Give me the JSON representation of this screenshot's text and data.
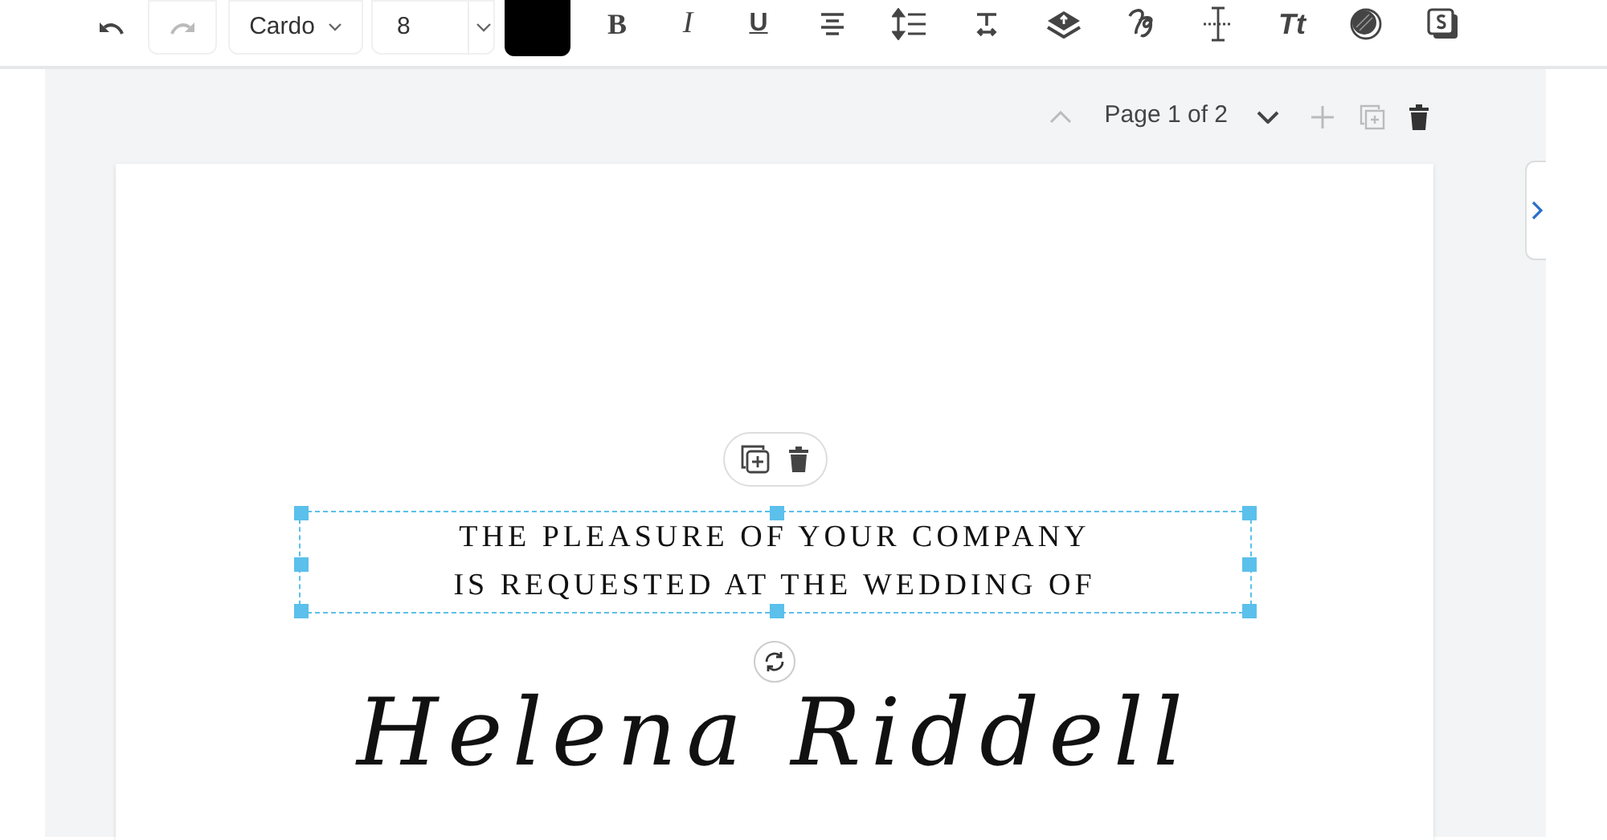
{
  "toolbar": {
    "undo": {
      "disabled": false
    },
    "redo": {
      "disabled": true
    },
    "font_family": "Cardo",
    "font_size": "8",
    "text_color": {
      "color": "#000000"
    },
    "format_buttons": [
      {
        "kind": "bold",
        "label": "B"
      },
      {
        "kind": "italic",
        "label": "I"
      },
      {
        "kind": "underline",
        "label": "U"
      },
      {
        "kind": "align"
      },
      {
        "kind": "line-spacing"
      },
      {
        "kind": "letter-spacing"
      },
      {
        "kind": "layers"
      },
      {
        "kind": "script"
      },
      {
        "kind": "baseline"
      },
      {
        "kind": "case",
        "label": "Tt"
      },
      {
        "kind": "opacity"
      },
      {
        "kind": "style"
      }
    ]
  },
  "page_nav": {
    "label": "Page 1 of 2",
    "previous_disabled": true,
    "next_disabled": false,
    "add_disabled": true,
    "duplicate_disabled": true
  },
  "canvas": {
    "text_box": {
      "selected": true,
      "lines": [
        "THE PLEASURE OF YOUR COMPANY",
        "IS REQUESTED AT THE WEDDING OF"
      ]
    },
    "names": "Helena Riddell"
  }
}
